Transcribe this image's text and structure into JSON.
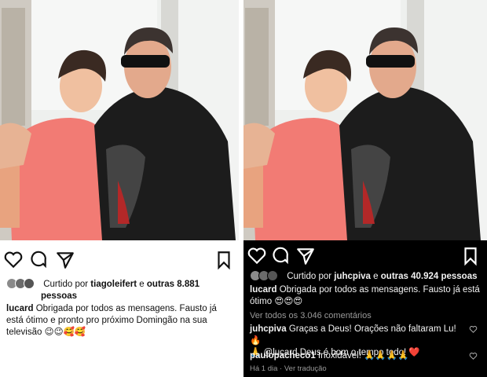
{
  "left_post": {
    "liked_by_prefix": "Curtido por",
    "liked_by_user": "tiagoleifert",
    "liked_by_and": "e",
    "liked_by_count": "outras 8.881",
    "liked_by_suffix": "pessoas",
    "caption_user": "lucard",
    "caption_text": "Obrigada por todos as mensagens. Fausto já está ótimo e pronto pro próximo Domingão na sua televisão",
    "caption_emojis": "😉😉🥰🥰"
  },
  "right_post": {
    "liked_by_prefix": "Curtido por",
    "liked_by_user": "juhcpiva",
    "liked_by_and": "e",
    "liked_by_count": "outras 40.924 pessoas",
    "caption_user": "lucard",
    "caption_text": "Obrigada por todos as mensagens. Fausto já está ótimo",
    "caption_emojis": "😍😍😍",
    "view_comments": "Ver todos os 3.046 comentários",
    "comments": [
      {
        "user": "juhcpiva",
        "text": "Graças a Deus! Orações não faltaram Lu! 🔥",
        "text2": "🙏 @lucard Deus é bom o tempo todo! ❤️"
      },
      {
        "user": "paulopacheco1",
        "text": "Inoxidável! 🙏🙏🙏🙏"
      }
    ],
    "time": "Há 1 dia",
    "translate": "Ver tradução"
  },
  "colors": {
    "dark_bg": "#000000",
    "light_bg": "#ffffff",
    "shirt": "#f27b74",
    "jacket": "#1c1c1c"
  }
}
